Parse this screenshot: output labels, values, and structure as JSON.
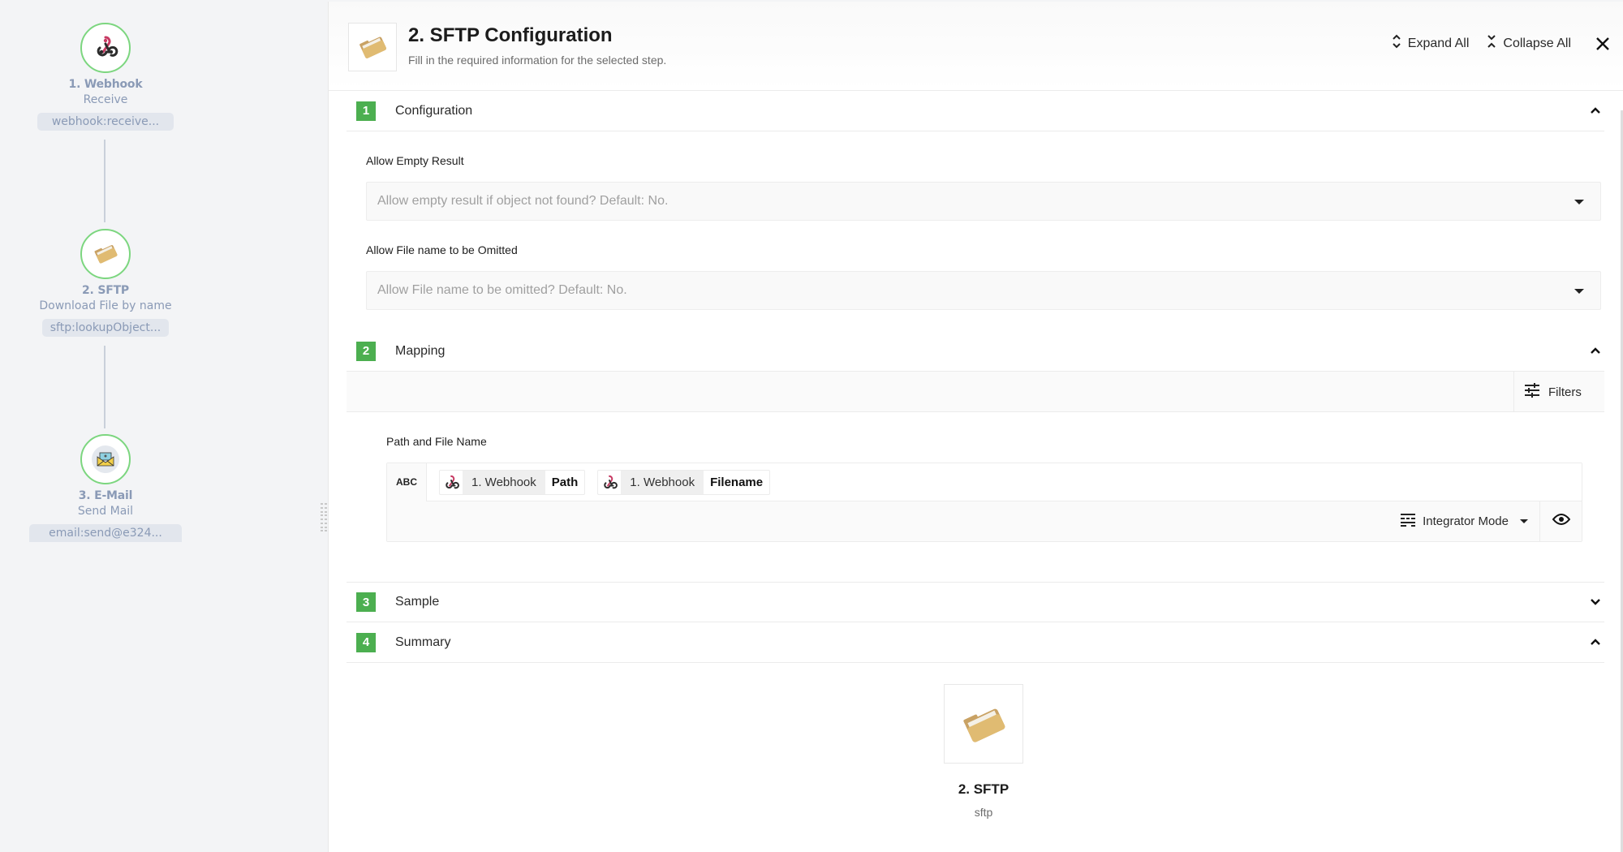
{
  "flow": {
    "nodes": [
      {
        "icon": "webhook-icon",
        "title": "1. Webhook",
        "subtitle": "Receive",
        "pill": "webhook:receive..."
      },
      {
        "icon": "folder-icon",
        "title": "2. SFTP",
        "subtitle": "Download File by name",
        "pill": "sftp:lookupObject..."
      },
      {
        "icon": "envelope-icon",
        "title": "3. E-Mail",
        "subtitle": "Send Mail",
        "pill": "email:send@e324..."
      }
    ]
  },
  "header": {
    "title": "2. SFTP Configuration",
    "subtitle": "Fill in the required information for the selected step.",
    "expand_all": "Expand All",
    "collapse_all": "Collapse All"
  },
  "sections": [
    {
      "number": "1",
      "title": "Configuration",
      "expanded": true
    },
    {
      "number": "2",
      "title": "Mapping",
      "expanded": true
    },
    {
      "number": "3",
      "title": "Sample",
      "expanded": false
    },
    {
      "number": "4",
      "title": "Summary",
      "expanded": true
    }
  ],
  "configuration": {
    "fields": [
      {
        "label": "Allow Empty Result",
        "placeholder": "Allow empty result if object not found? Default: No."
      },
      {
        "label": "Allow File name to be Omitted",
        "placeholder": "Allow File name to be omitted? Default: No."
      }
    ]
  },
  "mapping": {
    "filters_label": "Filters",
    "field_label": "Path and File Name",
    "type_badge": "ABC",
    "tokens": [
      {
        "source": "1. Webhook",
        "field": "Path"
      },
      {
        "source": "1. Webhook",
        "field": "Filename"
      }
    ],
    "mode_label": "Integrator Mode"
  },
  "summary": {
    "name": "2. SFTP",
    "type": "sftp"
  },
  "colors": {
    "accent_green": "#4caf50",
    "node_ring": "#7cd67f",
    "webhook_red": "#c73a63"
  }
}
